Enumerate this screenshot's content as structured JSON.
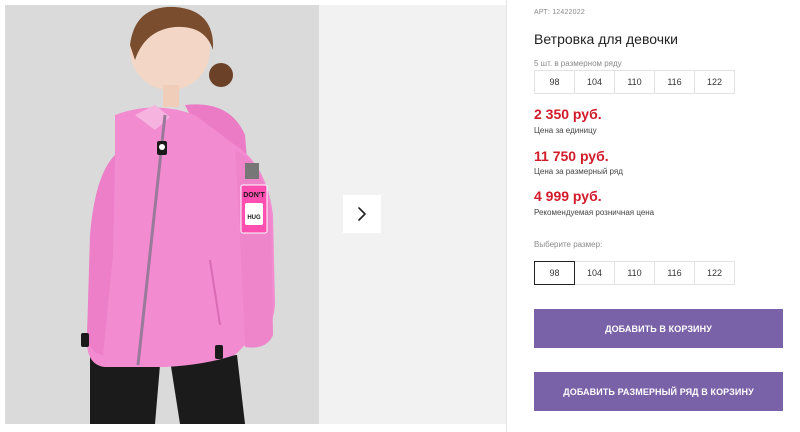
{
  "gallery": {
    "next_icon": "chevron-right-icon",
    "patch_text_top": "DON'T",
    "patch_text_bottom": "HUG"
  },
  "product": {
    "article": "АРТ: 12422022",
    "title": "Ветровка для девочки",
    "range_caption": "5 шт. в размерном ряду",
    "range_sizes": [
      "98",
      "104",
      "110",
      "116",
      "122"
    ]
  },
  "prices": {
    "unit_price": "2 350 руб.",
    "unit_caption": "Цена за единицу",
    "range_price": "11 750 руб.",
    "range_caption": "Цена за размерный ряд",
    "retail_price": "4 999 руб.",
    "retail_caption": "Рекомендуемая розничная цена"
  },
  "size_select": {
    "label": "Выберите размер:",
    "options": [
      "98",
      "104",
      "110",
      "116",
      "122"
    ],
    "selected": "98"
  },
  "buttons": {
    "add_to_cart": "ДОБАВИТЬ В КОРЗИНУ",
    "add_range_to_cart": "ДОБАВИТЬ РАЗМЕРНЫЙ РЯД В КОРЗИНУ"
  },
  "colors": {
    "accent": "#7a62a8",
    "price": "#d21a2a",
    "jacket": "#f07cc8"
  }
}
